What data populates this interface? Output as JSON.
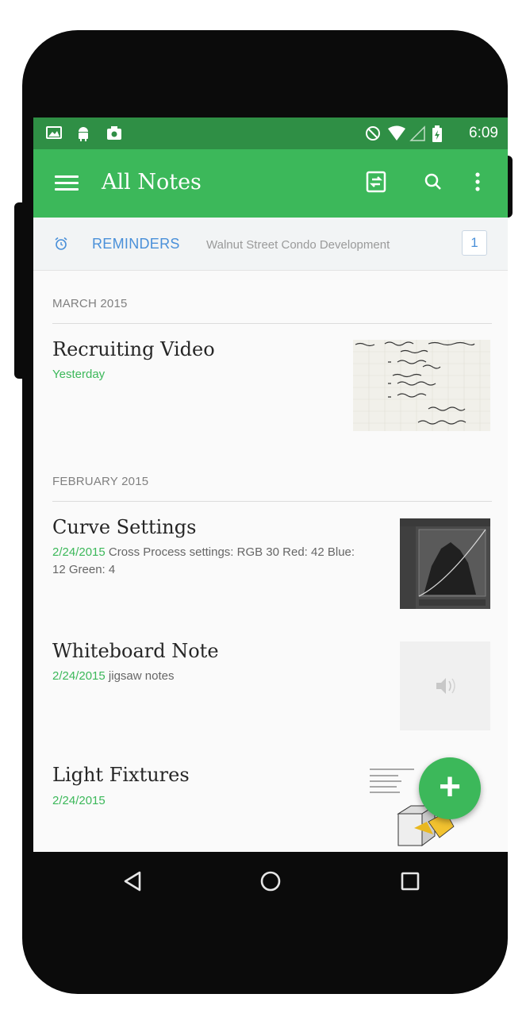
{
  "status_bar": {
    "time": "6:09",
    "left_icons": [
      "gallery-icon",
      "android-icon",
      "screenshot-icon"
    ],
    "right_icons": [
      "do-not-disturb-icon",
      "wifi-icon",
      "signal-icon",
      "battery-icon"
    ]
  },
  "app_bar": {
    "title": "All Notes",
    "actions": [
      "sync-icon",
      "search-icon",
      "overflow-menu-icon"
    ]
  },
  "reminders": {
    "label": "REMINDERS",
    "note": "Walnut Street Condo Development",
    "count": "1"
  },
  "sections": [
    {
      "heading": "MARCH 2015",
      "notes": [
        {
          "title": "Recruiting Video",
          "date": "Yesterday",
          "snippet": "",
          "thumbnail": "handwritten-notes-thumbnail"
        }
      ]
    },
    {
      "heading": "FEBRUARY 2015",
      "notes": [
        {
          "title": "Curve Settings",
          "date": "2/24/2015",
          "snippet": "Cross Process settings: RGB 30 Red: 42 Blue: 12 Green: 4",
          "thumbnail": "curves-screenshot-thumbnail"
        },
        {
          "title": "Whiteboard Note",
          "date": "2/24/2015",
          "snippet": "jigsaw notes",
          "thumbnail": "audio-thumbnail"
        },
        {
          "title": "Light Fixtures",
          "date": "2/24/2015",
          "snippet": "",
          "thumbnail": "sketch-thumbnail"
        }
      ]
    }
  ],
  "fab": {
    "label": "+",
    "icon": "add-note-icon"
  },
  "nav_bar": {
    "icons": [
      "back-icon",
      "home-icon",
      "recents-icon"
    ]
  },
  "colors": {
    "accent": "#3cb85a",
    "status_bar": "#2f8f45",
    "reminder_blue": "#4a90d9",
    "phone_body": "#0b0b0b"
  }
}
